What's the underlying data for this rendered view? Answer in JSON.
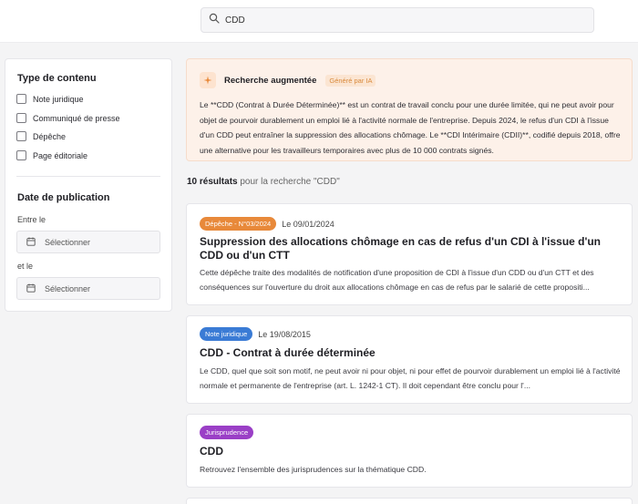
{
  "search": {
    "value": "CDD",
    "icon": "search-icon"
  },
  "filters": {
    "content_type": {
      "title": "Type de contenu",
      "options": [
        "Note juridique",
        "Communiqué de presse",
        "Dépêche",
        "Page éditoriale"
      ]
    },
    "publication_date": {
      "title": "Date de publication",
      "from_label": "Entre le",
      "to_label": "et le",
      "placeholder": "Sélectionner"
    }
  },
  "ai_summary": {
    "title": "Recherche augmentée",
    "badge": "Généré par IA",
    "text": "Le **CDD (Contrat à Durée Déterminée)** est un contrat de travail conclu pour une durée limitée, qui ne peut avoir pour objet de pourvoir durablement un emploi lié à l'activité normale de l'entreprise. Depuis 2024, le refus d'un CDI à l'issue d'un CDD peut entraîner la suppression des allocations chômage. Le **CDI Intérimaire (CDII)**, codifié depuis 2018, offre une alternative pour les travailleurs temporaires avec plus de 10 000 contrats signés."
  },
  "results": {
    "count_bold": "10 résultats",
    "count_rest": " pour la recherche \"CDD\"",
    "items": [
      {
        "tag": "Dépêche - N°03/2024",
        "tag_color": "#e8893a",
        "date": "Le 09/01/2024",
        "title": "Suppression des allocations chômage en cas de refus d'un CDI à l'issue d'un CDD ou d'un CTT",
        "excerpt": "Cette dépêche traite des modalités de notification d'une proposition de CDI à l'issue d'un CDD ou d'un CTT et des conséquences sur l'ouverture du droit aux allocations chômage en cas de refus par le salarié de cette propositi..."
      },
      {
        "tag": "Note juridique",
        "tag_color": "#3a7bd5",
        "date": "Le 19/08/2015",
        "title": "CDD - Contrat à durée déterminée",
        "excerpt": "Le CDD, quel que soit son motif, ne peut avoir ni pour objet, ni pour effet de pourvoir durablement un emploi lié à l'activité normale et permanente de l'entreprise (art. L. 1242-1 CT). Il doit cependant être conclu pour l'..."
      },
      {
        "tag": "Jurisprudence",
        "tag_color": "#9a3fc6",
        "date": "",
        "title": "CDD",
        "excerpt": "Retrouvez l'ensemble des jurisprudences sur la thématique CDD."
      }
    ]
  }
}
